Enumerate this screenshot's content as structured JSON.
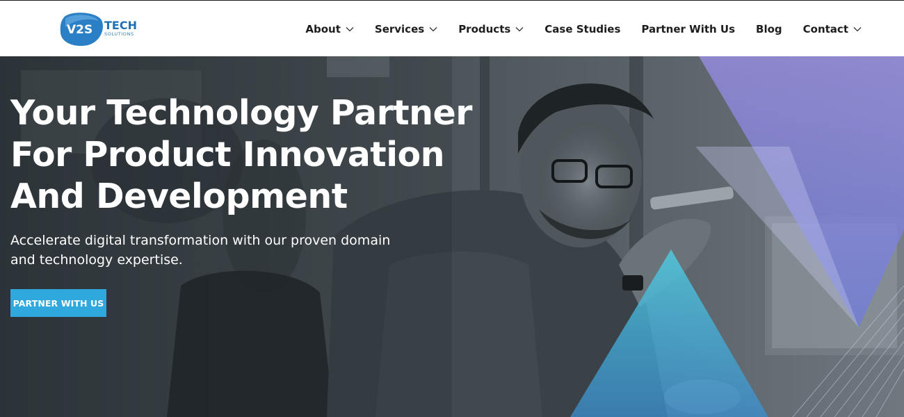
{
  "brand": {
    "logo_mark": "V2S",
    "logo_word": "TECH",
    "logo_sub": "SOLUTIONS",
    "colors": {
      "mark_blue": "#2b7fc4",
      "word_blue": "#1f6fb2"
    }
  },
  "nav": {
    "items": [
      {
        "label": "About",
        "has_dropdown": true
      },
      {
        "label": "Services",
        "has_dropdown": true
      },
      {
        "label": "Products",
        "has_dropdown": true
      },
      {
        "label": "Case Studies",
        "has_dropdown": false
      },
      {
        "label": "Partner With Us",
        "has_dropdown": false
      },
      {
        "label": "Blog",
        "has_dropdown": false
      },
      {
        "label": "Contact",
        "has_dropdown": true
      }
    ]
  },
  "hero": {
    "headline_lines": [
      "Your Technology Partner",
      "For Product Innovation",
      "And Development"
    ],
    "subtext": "Accelerate digital transformation with our proven domain and technology expertise.",
    "cta_label": "PARTNER WITH US",
    "colors": {
      "cta": "#2ea8dd",
      "accent_purple": "#8a84e6",
      "accent_cyan": "#3cc3de",
      "overlay": "#3b4247"
    }
  }
}
